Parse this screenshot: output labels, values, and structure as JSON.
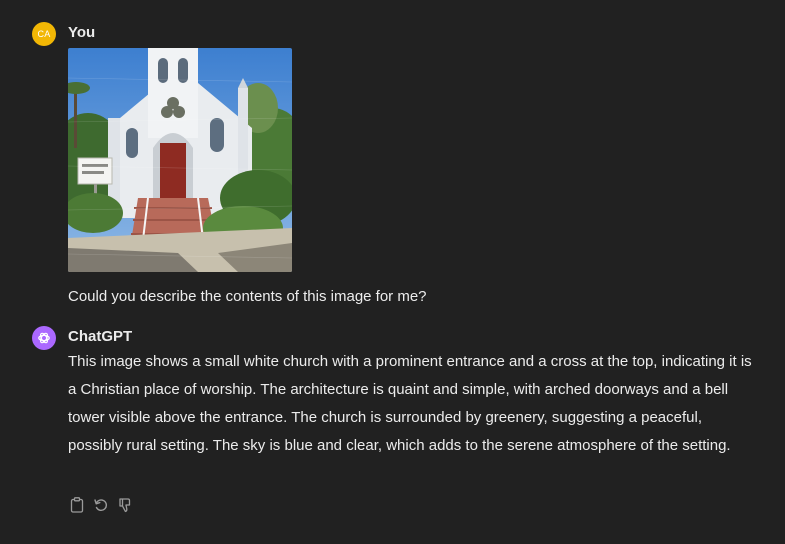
{
  "user": {
    "initials": "CA",
    "name": "You",
    "avatar_color": "#f2b705",
    "message": "Could you describe the contents of this image for me?"
  },
  "assistant": {
    "name": "ChatGPT",
    "avatar_color": "#ab68ff",
    "icon": "openai-logo-icon",
    "message": "This image shows a small white church with a prominent entrance and a cross at the top, indicating it is a Christian place of worship. The architecture is quaint and simple, with arched doorways and a bell tower visible above the entrance. The church is surrounded by greenery, suggesting a peaceful, possibly rural setting. The sky is blue and clear, which adds to the serene atmosphere of the setting."
  },
  "actions": [
    {
      "icon": "clipboard-icon"
    },
    {
      "icon": "regenerate-icon"
    },
    {
      "icon": "thumbs-down-icon"
    }
  ]
}
